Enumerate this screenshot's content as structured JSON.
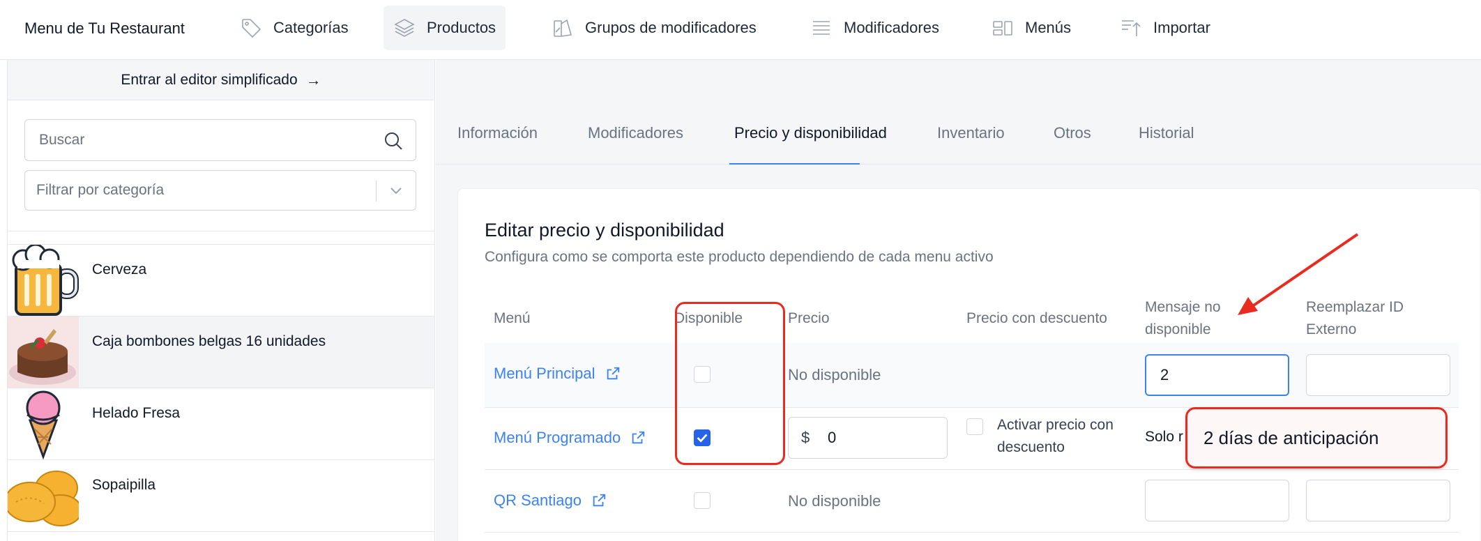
{
  "nav": {
    "brand": "Menu de Tu Restaurant",
    "items": [
      {
        "label": "Categorías",
        "icon": "tag-icon"
      },
      {
        "label": "Productos",
        "icon": "layers-icon",
        "active": true
      },
      {
        "label": "Grupos de modificadores",
        "icon": "modifier-groups-icon"
      },
      {
        "label": "Modificadores",
        "icon": "list-icon"
      },
      {
        "label": "Menús",
        "icon": "layout-icon"
      },
      {
        "label": "Importar",
        "icon": "import-icon"
      }
    ]
  },
  "sidebar": {
    "simple_editor": "Entrar al editor simplificado",
    "search_placeholder": "Buscar",
    "filter_placeholder": "Filtrar por categoría",
    "products": [
      {
        "name": "Cerveza",
        "image": "beer-mug-image"
      },
      {
        "name": "Caja bombones belgas 16 unidades",
        "image": "chocolate-cake-image",
        "selected": true
      },
      {
        "name": "Helado Fresa",
        "image": "ice-cream-image"
      },
      {
        "name": "Sopaipilla",
        "image": "sopaipilla-image"
      }
    ]
  },
  "tabs": [
    "Información",
    "Modificadores",
    "Precio y disponibilidad",
    "Inventario",
    "Otros",
    "Historial"
  ],
  "active_tab": "Precio y disponibilidad",
  "card": {
    "title": "Editar precio y disponibilidad",
    "subtitle": "Configura como se comporta este producto dependiendo de cada menu activo",
    "columns": {
      "menu": "Menú",
      "available": "Disponible",
      "price": "Precio",
      "discount": "Precio con descuento",
      "unavailable_msg_1": "Mensaje no",
      "unavailable_msg_2": "disponible",
      "external_id_1": "Reemplazar ID",
      "external_id_2": "Externo"
    },
    "rows": [
      {
        "menu": "Menú Principal",
        "available": false,
        "price_text": "No disponible",
        "message": "2",
        "external_id": ""
      },
      {
        "menu": "Menú Programado",
        "available": true,
        "currency": "$",
        "price": "0",
        "discount_label_1": "Activar precio con",
        "discount_label_2": "descuento",
        "message_prefix": "Solo r"
      },
      {
        "menu": "QR Santiago",
        "available": false,
        "price_text": "No disponible",
        "message": "",
        "external_id": ""
      }
    ]
  },
  "tooltip": "2 días de anticipación",
  "colors": {
    "accent": "#3b82f6",
    "annotation": "#ea2a1f",
    "checkbox_on": "#2563eb"
  }
}
